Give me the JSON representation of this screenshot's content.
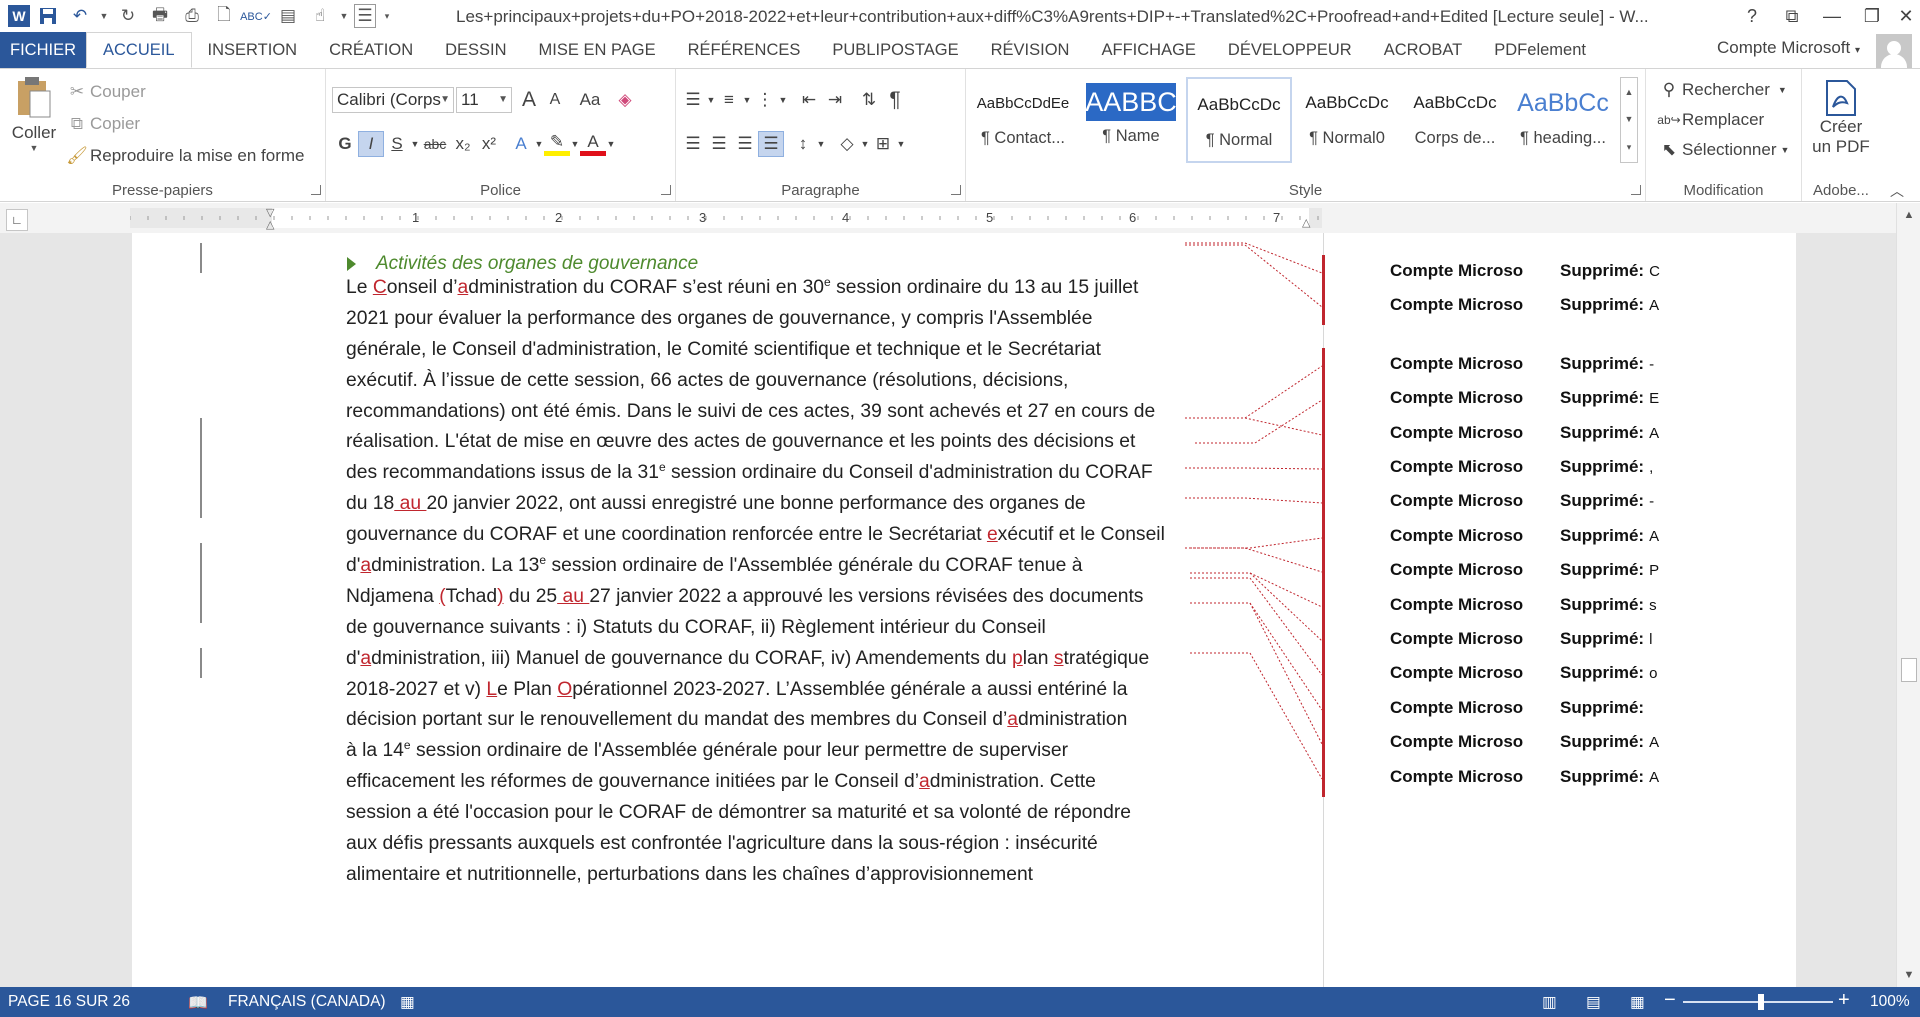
{
  "window": {
    "title": "Les+principaux+projets+du+PO+2018-2022+et+leur+contribution+aux+diff%C3%A9rents+DIP+-+Translated%2C+Proofread+and+Edited [Lecture seule] - W...",
    "help": "?"
  },
  "tabs": [
    "FICHIER",
    "ACCUEIL",
    "INSERTION",
    "CRÉATION",
    "DESSIN",
    "MISE EN PAGE",
    "RÉFÉRENCES",
    "PUBLIPOSTAGE",
    "RÉVISION",
    "AFFICHAGE",
    "DÉVELOPPEUR",
    "ACROBAT",
    "PDFelement"
  ],
  "account": "Compte Microsoft",
  "clipboard": {
    "paste": "Coller",
    "cut": "Couper",
    "copy": "Copier",
    "format_painter": "Reproduire la mise en forme",
    "label": "Presse-papiers"
  },
  "font": {
    "name": "Calibri (Corps",
    "size": "11",
    "label": "Police",
    "bold": "G",
    "italic": "I",
    "underline": "S",
    "strike": "abc",
    "change_case": "Aa",
    "grow": "A",
    "shrink": "A"
  },
  "paragraph": {
    "label": "Paragraphe",
    "pilcrow": "¶"
  },
  "styles": {
    "label": "Style",
    "items": [
      {
        "sample": "AaBbCcDdEe",
        "name": "¶ Contact..."
      },
      {
        "sample": "AABBC",
        "name": "¶ Name"
      },
      {
        "sample": "AaBbCcDc",
        "name": "¶ Normal"
      },
      {
        "sample": "AaBbCcDc",
        "name": "¶ Normal0"
      },
      {
        "sample": "AaBbCcDc",
        "name": "Corps de..."
      },
      {
        "sample": "AaBbCc",
        "name": "¶ heading..."
      }
    ]
  },
  "editing": {
    "label": "Modification",
    "find": "Rechercher",
    "replace": "Remplacer",
    "select": "Sélectionner"
  },
  "adobe": {
    "create_pdf_1": "Créer",
    "create_pdf_2": "un PDF",
    "label": "Adobe..."
  },
  "ruler": {
    "numbers": [
      "1",
      "2",
      "3",
      "4",
      "5",
      "6",
      "7"
    ]
  },
  "document": {
    "heading": "Activités des organes de gouvernance",
    "balloons": [
      {
        "author": "Compte Microso",
        "kind": "Supprimé:",
        "value": "C"
      },
      {
        "author": "Compte Microso",
        "kind": "Supprimé:",
        "value": "A"
      },
      {
        "author": "Compte Microso",
        "kind": "Supprimé:",
        "value": "-"
      },
      {
        "author": "Compte Microso",
        "kind": "Supprimé:",
        "value": "E"
      },
      {
        "author": "Compte Microso",
        "kind": "Supprimé:",
        "value": "A"
      },
      {
        "author": "Compte Microso",
        "kind": "Supprimé:",
        "value": ","
      },
      {
        "author": "Compte Microso",
        "kind": "Supprimé:",
        "value": "-"
      },
      {
        "author": "Compte Microso",
        "kind": "Supprimé:",
        "value": "A"
      },
      {
        "author": "Compte Microso",
        "kind": "Supprimé:",
        "value": "P"
      },
      {
        "author": "Compte Microso",
        "kind": "Supprimé:",
        "value": "s"
      },
      {
        "author": "Compte Microso",
        "kind": "Supprimé:",
        "value": "l"
      },
      {
        "author": "Compte Microso",
        "kind": "Supprimé:",
        "value": "o"
      },
      {
        "author": "Compte Microso",
        "kind": "Supprimé:",
        "value": ""
      },
      {
        "author": "Compte Microso",
        "kind": "Supprimé:",
        "value": "A"
      },
      {
        "author": "Compte Microso",
        "kind": "Supprimé:",
        "value": "A"
      }
    ]
  },
  "status": {
    "page": "PAGE 16 SUR 26",
    "language": "FRANÇAIS (CANADA)",
    "zoom": "100%",
    "zoom_minus": "−",
    "zoom_plus": "+"
  },
  "colors": {
    "accent": "#2b579a",
    "revision": "#c0262e",
    "heading": "#4e8a2e"
  }
}
